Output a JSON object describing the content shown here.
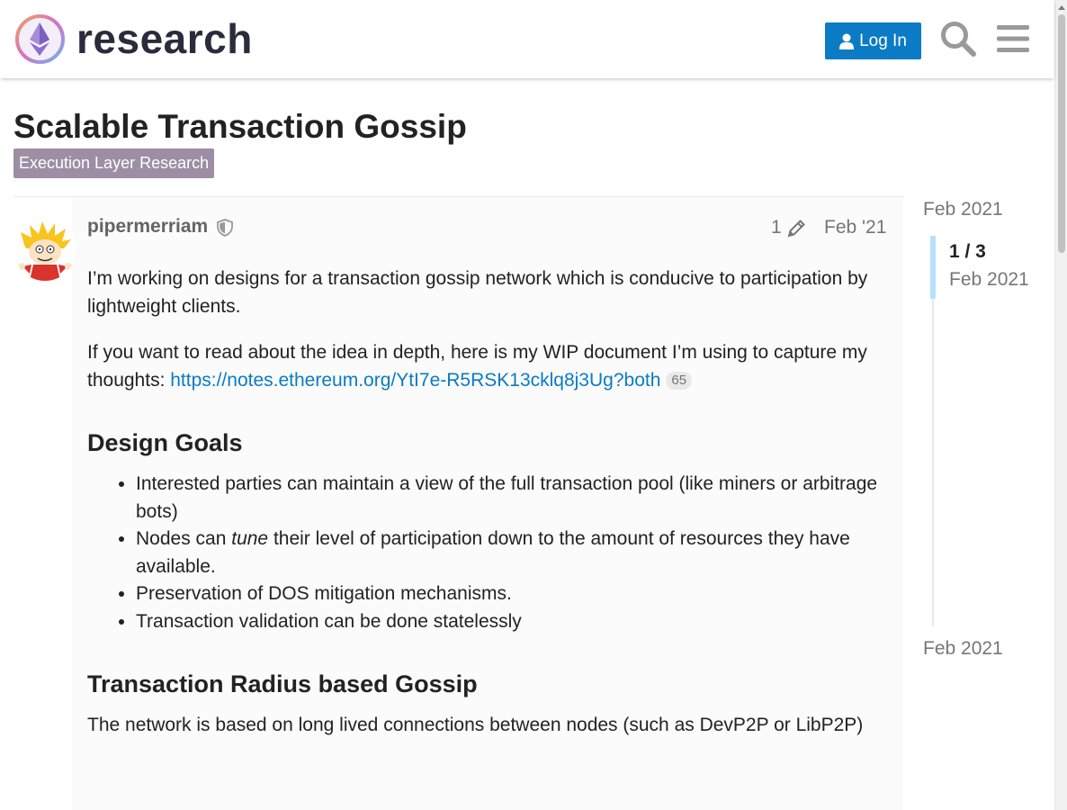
{
  "header": {
    "logo_text": "research",
    "login_label": "Log In",
    "accent_color": "#0a7bc4"
  },
  "topic": {
    "title": "Scalable Transaction Gossip",
    "category": "Execution Layer Research",
    "category_color": "#9d8ea4"
  },
  "post": {
    "username": "pipermerriam",
    "edit_count": "1",
    "date": "Feb '21",
    "paragraphs": {
      "intro": "I’m working on designs for a transaction gossip network which is conducive to participation by lightweight clients.",
      "read_more_prefix": "If you want to read about the idea in depth, here is my WIP document I’m using to capture my thoughts: ",
      "link_text": "https://notes.ethereum.org/YtI7e-R5RSK13cklq8j3Ug?both",
      "link_clicks": "65"
    },
    "design_goals": {
      "heading": "Design Goals",
      "item1": "Interested parties can maintain a view of the full transaction pool (like miners or arbitrage bots)",
      "item2_pre": "Nodes can ",
      "item2_em": "tune",
      "item2_post": " their level of participation down to the amount of resources they have available.",
      "item3": "Preservation of DOS mitigation mechanisms.",
      "item4": "Transaction validation can be done statelessly"
    },
    "radius_section": {
      "heading": "Transaction Radius based Gossip",
      "paragraph": "The network is based on long lived connections between nodes (such as DevP2P or LibP2P)"
    }
  },
  "timeline": {
    "start_label": "Feb 2021",
    "position": "1 / 3",
    "position_date": "Feb 2021",
    "end_label": "Feb 2021"
  },
  "icons": {
    "user": "user-icon",
    "search": "search-icon",
    "menu": "hamburger-menu-icon",
    "shield": "shield-icon",
    "pencil": "pencil-icon"
  }
}
